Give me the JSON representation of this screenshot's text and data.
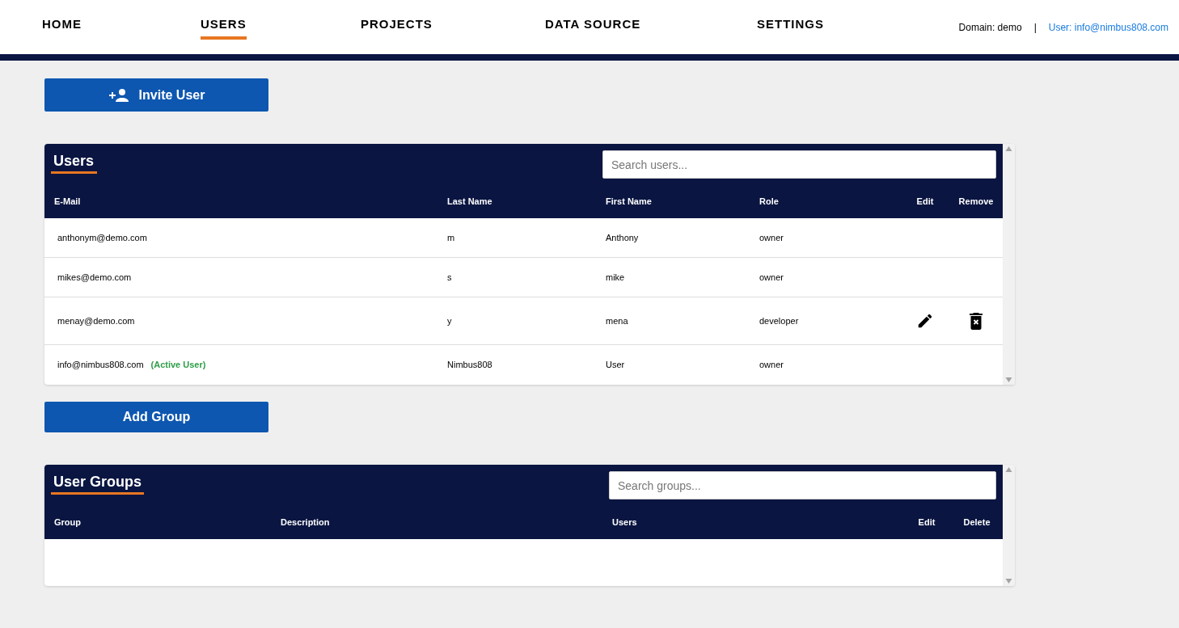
{
  "nav": {
    "items": [
      {
        "label": "HOME",
        "selected": false
      },
      {
        "label": "USERS",
        "selected": true
      },
      {
        "label": "PROJECTS",
        "selected": false
      },
      {
        "label": "DATA SOURCE",
        "selected": false
      },
      {
        "label": "SETTINGS",
        "selected": false
      }
    ],
    "domain": "Domain: demo",
    "separator": "|",
    "user": "User: info@nimbus808.com"
  },
  "invite_button": "Invite User",
  "users_table": {
    "title": "Users",
    "search": {
      "placeholder": "Search users..."
    },
    "columns": [
      "E-Mail",
      "Last Name",
      "First Name",
      "Role",
      "Edit",
      "Remove"
    ],
    "rows": [
      {
        "email": "anthonym@demo.com",
        "last_name": "m",
        "first_name": "Anthony",
        "role": "owner",
        "editable": false
      },
      {
        "email": "mikes@demo.com",
        "last_name": "s",
        "first_name": "mike",
        "role": "owner",
        "editable": false
      },
      {
        "email": "menay@demo.com",
        "last_name": "y",
        "first_name": "mena",
        "role": "developer",
        "editable": true
      },
      {
        "email": "info@nimbus808.com",
        "badge": "(Active User)",
        "last_name": "Nimbus808",
        "first_name": "User",
        "role": "owner",
        "editable": false
      }
    ]
  },
  "add_group_button": "Add Group",
  "groups_table": {
    "title": "User Groups",
    "search": {
      "placeholder": "Search groups..."
    },
    "columns": [
      "Group",
      "Description",
      "Users",
      "Edit",
      "Delete"
    ]
  }
}
